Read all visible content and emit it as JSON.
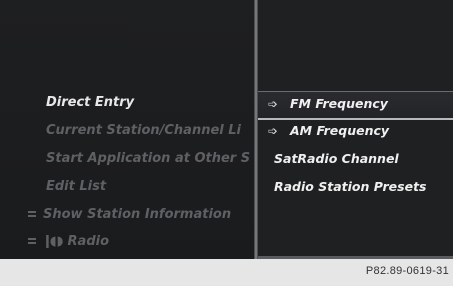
{
  "left_menu": {
    "items": [
      {
        "label": "Direct Entry",
        "active": true
      },
      {
        "label": "Current Station/Channel Li",
        "active": false
      },
      {
        "label": "Start Application at Other S",
        "active": false
      },
      {
        "label": "Edit List",
        "active": false
      }
    ],
    "show_info_label": "Show Station Information",
    "radio_label": "Radio"
  },
  "right_menu": {
    "items": [
      {
        "label": "FM Frequency",
        "icon": "arrow-into-icon",
        "selected": true
      },
      {
        "label": "AM Frequency",
        "icon": "arrow-into-icon",
        "selected": false
      },
      {
        "label": "SatRadio Channel",
        "icon": null,
        "selected": false
      },
      {
        "label": "Radio Station Presets",
        "icon": null,
        "selected": false
      }
    ]
  },
  "footer": {
    "code": "P82.89-0619-31"
  },
  "colors": {
    "screen_bg": "#1b1c1e",
    "active_text": "#e8e8e8",
    "inactive_text": "#5f6063",
    "footer_bg": "#e6e6e6"
  }
}
